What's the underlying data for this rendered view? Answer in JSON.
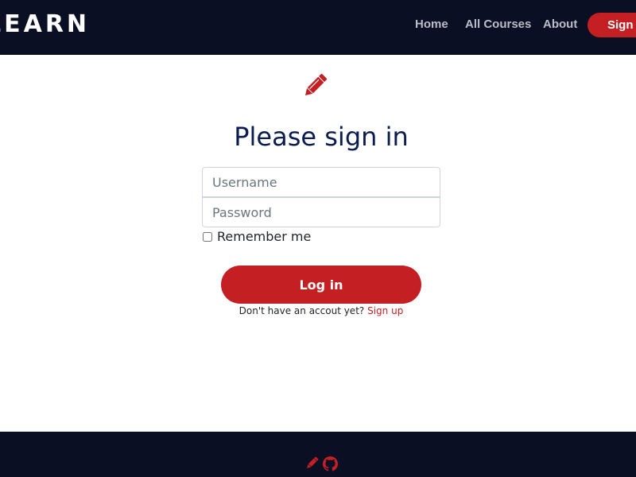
{
  "navbar": {
    "brand": "LEARN",
    "links": [
      "Home",
      "All Courses",
      "About"
    ],
    "signup_label": "Sign up"
  },
  "main": {
    "icon": "pencil-icon",
    "title": "Please sign in",
    "username_placeholder": "Username",
    "password_placeholder": "Password",
    "remember_label": "Remember me",
    "login_label": "Log in",
    "signup_prompt": "Don't have an accout yet?",
    "signup_link": "Sign up"
  },
  "footer": {
    "icons": [
      "pencil-icon",
      "github-icon"
    ]
  },
  "colors": {
    "navbar_bg": "#0a0f24",
    "accent": "#c42024",
    "title": "#0b1d4f"
  }
}
